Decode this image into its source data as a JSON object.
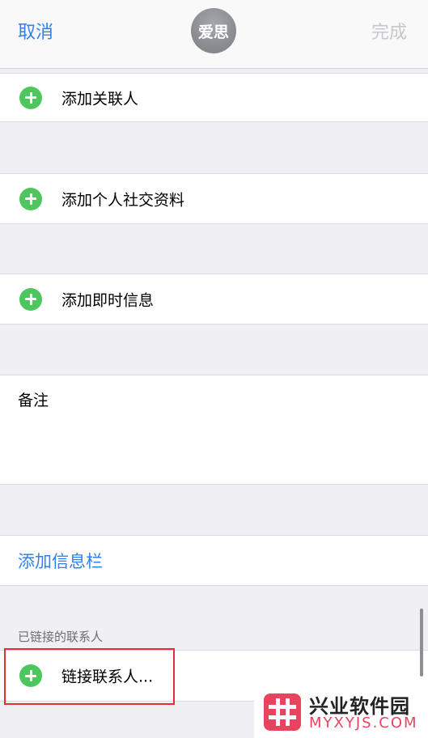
{
  "nav": {
    "cancel_label": "取消",
    "avatar_text": "爱思",
    "done_label": "完成"
  },
  "rows": {
    "related": "添加关联人",
    "social": "添加个人社交资料",
    "im": "添加即时信息"
  },
  "notes": {
    "label": "备注"
  },
  "add_field": {
    "label": "添加信息栏"
  },
  "linked": {
    "header": "已链接的联系人",
    "link_label": "链接联系人..."
  },
  "watermark": {
    "name": "兴业软件园",
    "url": "MYXYJS.COM"
  },
  "colors": {
    "accent": "#2f7ff5",
    "add_green": "#4dc65e",
    "highlight_red": "#e0312f",
    "watermark_pink": "#e8445f"
  }
}
